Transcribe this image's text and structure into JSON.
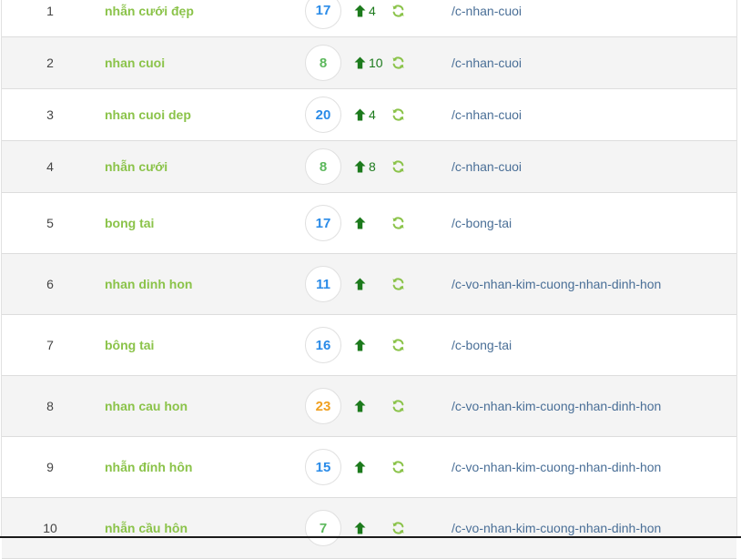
{
  "rows": [
    {
      "rank": "1",
      "keyword": "nhẫn cưới đẹp",
      "position": "17",
      "pos_color": "blue",
      "change": "4",
      "url": "/c-nhan-cuoi"
    },
    {
      "rank": "2",
      "keyword": "nhan cuoi",
      "position": "8",
      "pos_color": "green",
      "change": "10",
      "url": "/c-nhan-cuoi"
    },
    {
      "rank": "3",
      "keyword": "nhan cuoi dep",
      "position": "20",
      "pos_color": "blue",
      "change": "4",
      "url": "/c-nhan-cuoi"
    },
    {
      "rank": "4",
      "keyword": "nhẫn cưới",
      "position": "8",
      "pos_color": "green",
      "change": "8",
      "url": "/c-nhan-cuoi"
    },
    {
      "rank": "5",
      "keyword": "bong tai",
      "position": "17",
      "pos_color": "blue",
      "change": "",
      "url": "/c-bong-tai"
    },
    {
      "rank": "6",
      "keyword": "nhan dinh hon",
      "position": "11",
      "pos_color": "blue",
      "change": "",
      "url": "/c-vo-nhan-kim-cuong-nhan-dinh-hon"
    },
    {
      "rank": "7",
      "keyword": "bông tai",
      "position": "16",
      "pos_color": "blue",
      "change": "",
      "url": "/c-bong-tai"
    },
    {
      "rank": "8",
      "keyword": "nhan cau hon",
      "position": "23",
      "pos_color": "orange",
      "change": "",
      "url": "/c-vo-nhan-kim-cuong-nhan-dinh-hon"
    },
    {
      "rank": "9",
      "keyword": "nhẫn đính hôn",
      "position": "15",
      "pos_color": "blue",
      "change": "",
      "url": "/c-vo-nhan-kim-cuong-nhan-dinh-hon"
    },
    {
      "rank": "10",
      "keyword": "nhẫn cầu hôn",
      "position": "7",
      "pos_color": "green",
      "change": "",
      "url": "/c-vo-nhan-kim-cuong-nhan-dinh-hon"
    }
  ],
  "colors": {
    "keyword": "#8bc34a",
    "position_blue": "#2a8be8",
    "position_green": "#5cb85c",
    "position_orange": "#f0a020",
    "arrow_up": "#1c7a1c",
    "refresh": "#8bc34a",
    "url": "#4a6f97"
  },
  "icons": {
    "change": "arrow-up-icon",
    "refresh": "refresh-icon"
  }
}
